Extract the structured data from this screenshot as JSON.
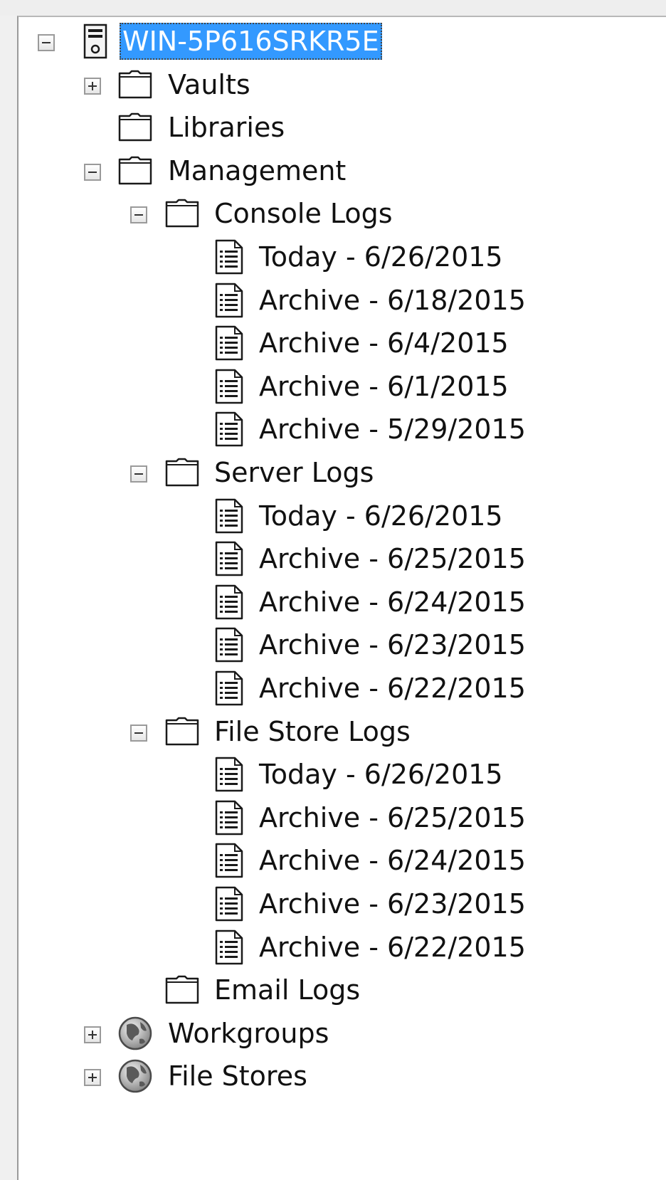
{
  "tree": {
    "root": {
      "label": "WIN-5P616SRKR5E",
      "icon": "server-icon",
      "expanded": true,
      "selected": true
    },
    "vaults": {
      "label": "Vaults",
      "icon": "folder-icon",
      "expanded": false
    },
    "libraries": {
      "label": "Libraries",
      "icon": "folder-icon"
    },
    "management": {
      "label": "Management",
      "icon": "folder-icon",
      "expanded": true,
      "console_logs": {
        "label": "Console Logs",
        "icon": "folder-icon",
        "expanded": true,
        "items": [
          "Today - 6/26/2015",
          "Archive - 6/18/2015",
          "Archive - 6/4/2015",
          "Archive - 6/1/2015",
          "Archive - 5/29/2015"
        ]
      },
      "server_logs": {
        "label": "Server Logs",
        "icon": "folder-icon",
        "expanded": true,
        "items": [
          "Today - 6/26/2015",
          "Archive - 6/25/2015",
          "Archive - 6/24/2015",
          "Archive - 6/23/2015",
          "Archive - 6/22/2015"
        ]
      },
      "file_store_logs": {
        "label": "File Store Logs",
        "icon": "folder-icon",
        "expanded": true,
        "items": [
          "Today - 6/26/2015",
          "Archive - 6/25/2015",
          "Archive - 6/24/2015",
          "Archive - 6/23/2015",
          "Archive - 6/22/2015"
        ]
      },
      "email_logs": {
        "label": "Email Logs",
        "icon": "folder-icon"
      }
    },
    "workgroups": {
      "label": "Workgroups",
      "icon": "globe-icon",
      "expanded": false
    },
    "file_stores": {
      "label": "File Stores",
      "icon": "globe-icon",
      "expanded": false
    }
  },
  "colors": {
    "selection": "#3399ff",
    "selection_text": "#ffffff",
    "background": "#ffffff"
  }
}
